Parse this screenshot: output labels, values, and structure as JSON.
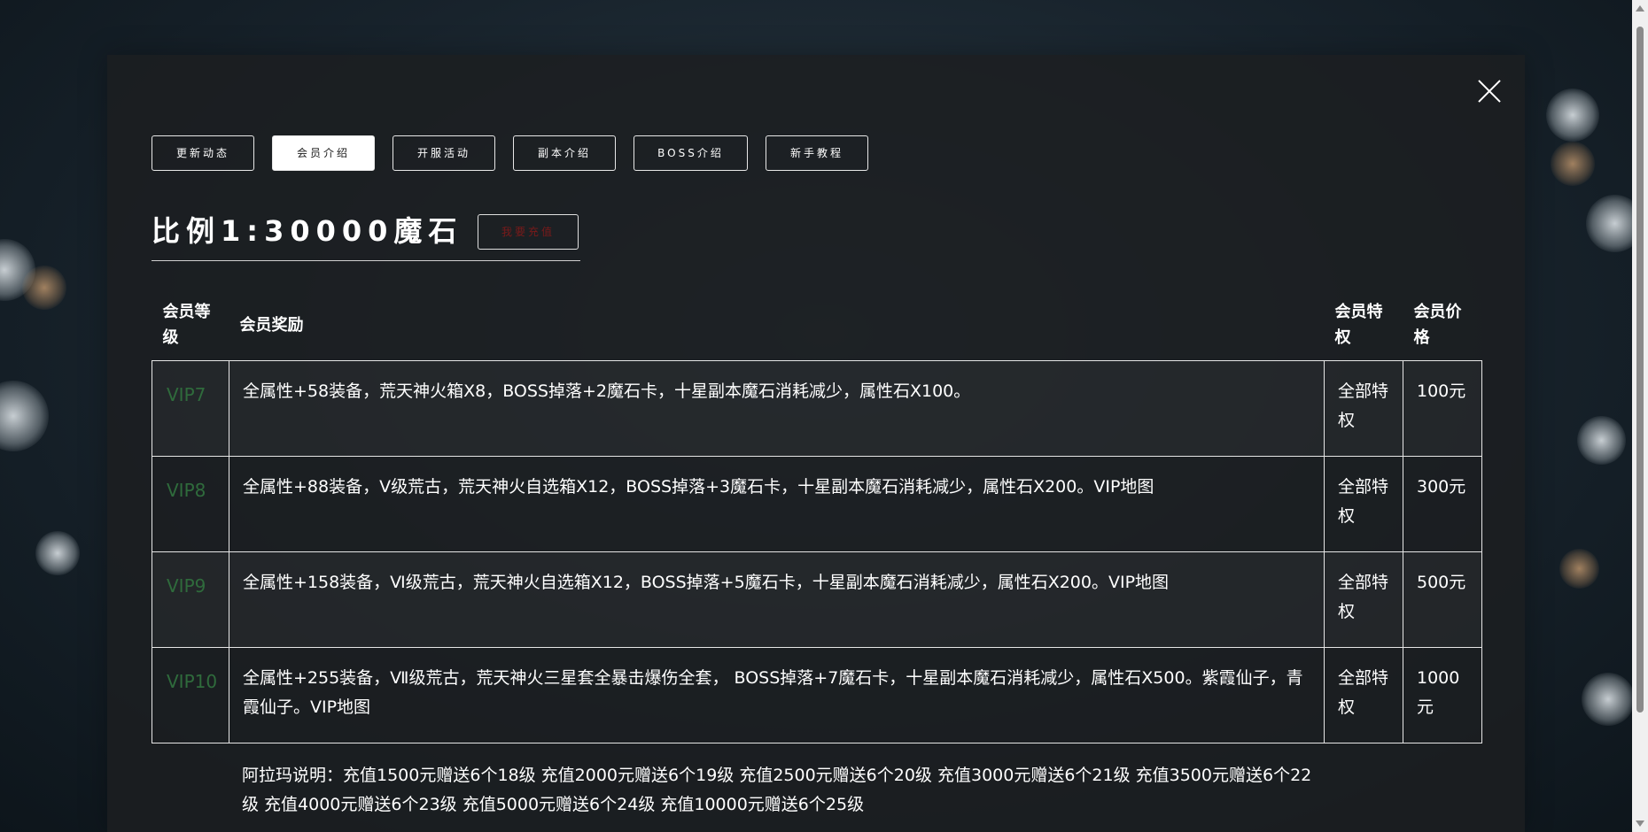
{
  "tabs": [
    {
      "label": "更新动态",
      "active": false
    },
    {
      "label": "会员介绍",
      "active": true
    },
    {
      "label": "开服活动",
      "active": false
    },
    {
      "label": "副本介绍",
      "active": false
    },
    {
      "label": "BOSS介绍",
      "active": false
    },
    {
      "label": "新手教程",
      "active": false
    }
  ],
  "title": {
    "ratio": "比例1:30000魔石",
    "recharge_label": "我要充值"
  },
  "table": {
    "headers": {
      "level": "会员等级",
      "reward": "会员奖励",
      "privilege": "会员特权",
      "price": "会员价格"
    },
    "rows": [
      {
        "level": "VIP7",
        "reward": "全属性+58装备，荒天神火箱X8，BOSS掉落+2魔石卡，十星副本魔石消耗减少，属性石X100。",
        "privilege": "全部特权",
        "price": "100元"
      },
      {
        "level": "VIP8",
        "reward": "全属性+88装备，Ⅴ级荒古，荒天神火自选箱X12，BOSS掉落+3魔石卡，十星副本魔石消耗减少，属性石X200。VIP地图",
        "privilege": "全部特权",
        "price": "300元"
      },
      {
        "level": "VIP9",
        "reward": "全属性+158装备，Ⅵ级荒古，荒天神火自选箱X12，BOSS掉落+5魔石卡，十星副本魔石消耗减少，属性石X200。VIP地图",
        "privilege": "全部特权",
        "price": "500元"
      },
      {
        "level": "VIP10",
        "reward": "全属性+255装备，Ⅶ级荒古，荒天神火三星套全暴击爆伤全套， BOSS掉落+7魔石卡，十星副本魔石消耗减少，属性石X500。紫霞仙子，青霞仙子。VIP地图",
        "privilege": "全部特权",
        "price": "1000元"
      }
    ]
  },
  "note": "阿拉玛说明：充值1500元赠送6个18级 充值2000元赠送6个19级 充值2500元赠送6个20级 充值3000元赠送6个21级 充值3500元赠送6个22级 充值4000元赠送6个23级 充值5000元赠送6个24级 充值10000元赠送6个25级",
  "colors": {
    "level_text": "#2f6b3c",
    "recharge_text": "#7a1a1a",
    "modal_bg": "#1c1e21"
  }
}
